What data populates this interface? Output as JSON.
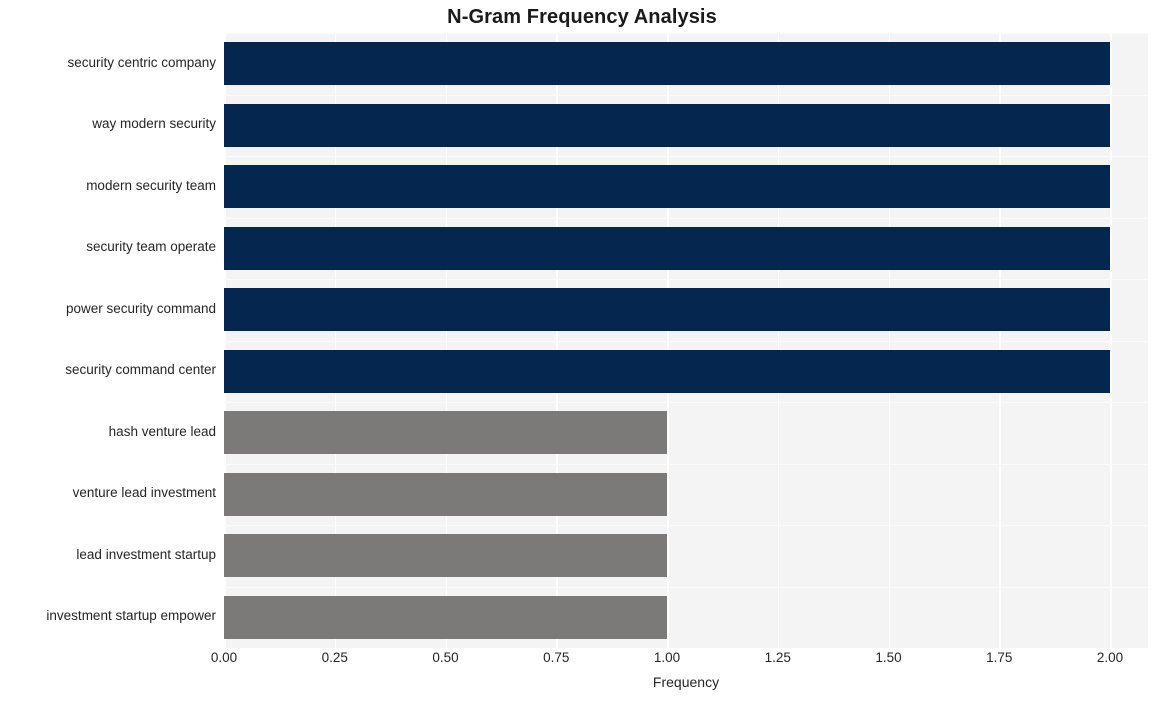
{
  "chart_data": {
    "type": "bar",
    "orientation": "horizontal",
    "title": "N-Gram Frequency Analysis",
    "xlabel": "Frequency",
    "ylabel": "",
    "categories": [
      "security centric company",
      "way modern security",
      "modern security team",
      "security team operate",
      "power security command",
      "security command center",
      "hash venture lead",
      "venture lead investment",
      "lead investment startup",
      "investment startup empower"
    ],
    "values": [
      2,
      2,
      2,
      2,
      2,
      2,
      1,
      1,
      1,
      1
    ],
    "bar_colors": [
      "#04264f",
      "#04264f",
      "#04264f",
      "#04264f",
      "#04264f",
      "#04264f",
      "#7b7a78",
      "#7b7a78",
      "#7b7a78",
      "#7b7a78"
    ],
    "xlim": [
      0,
      2.0
    ],
    "xticks": [
      0,
      0.25,
      0.5,
      0.75,
      1.0,
      1.25,
      1.5,
      1.75,
      2.0
    ],
    "xtick_labels": [
      "0.00",
      "0.25",
      "0.50",
      "0.75",
      "1.00",
      "1.25",
      "1.50",
      "1.75",
      "2.00"
    ],
    "grid": true,
    "grid_color": "#ffffff",
    "plot_background": "#f4f4f5",
    "figure_background": "#ffffff",
    "legend": null,
    "title_color": "#1a1a1a",
    "tick_label_color": "#262626"
  }
}
